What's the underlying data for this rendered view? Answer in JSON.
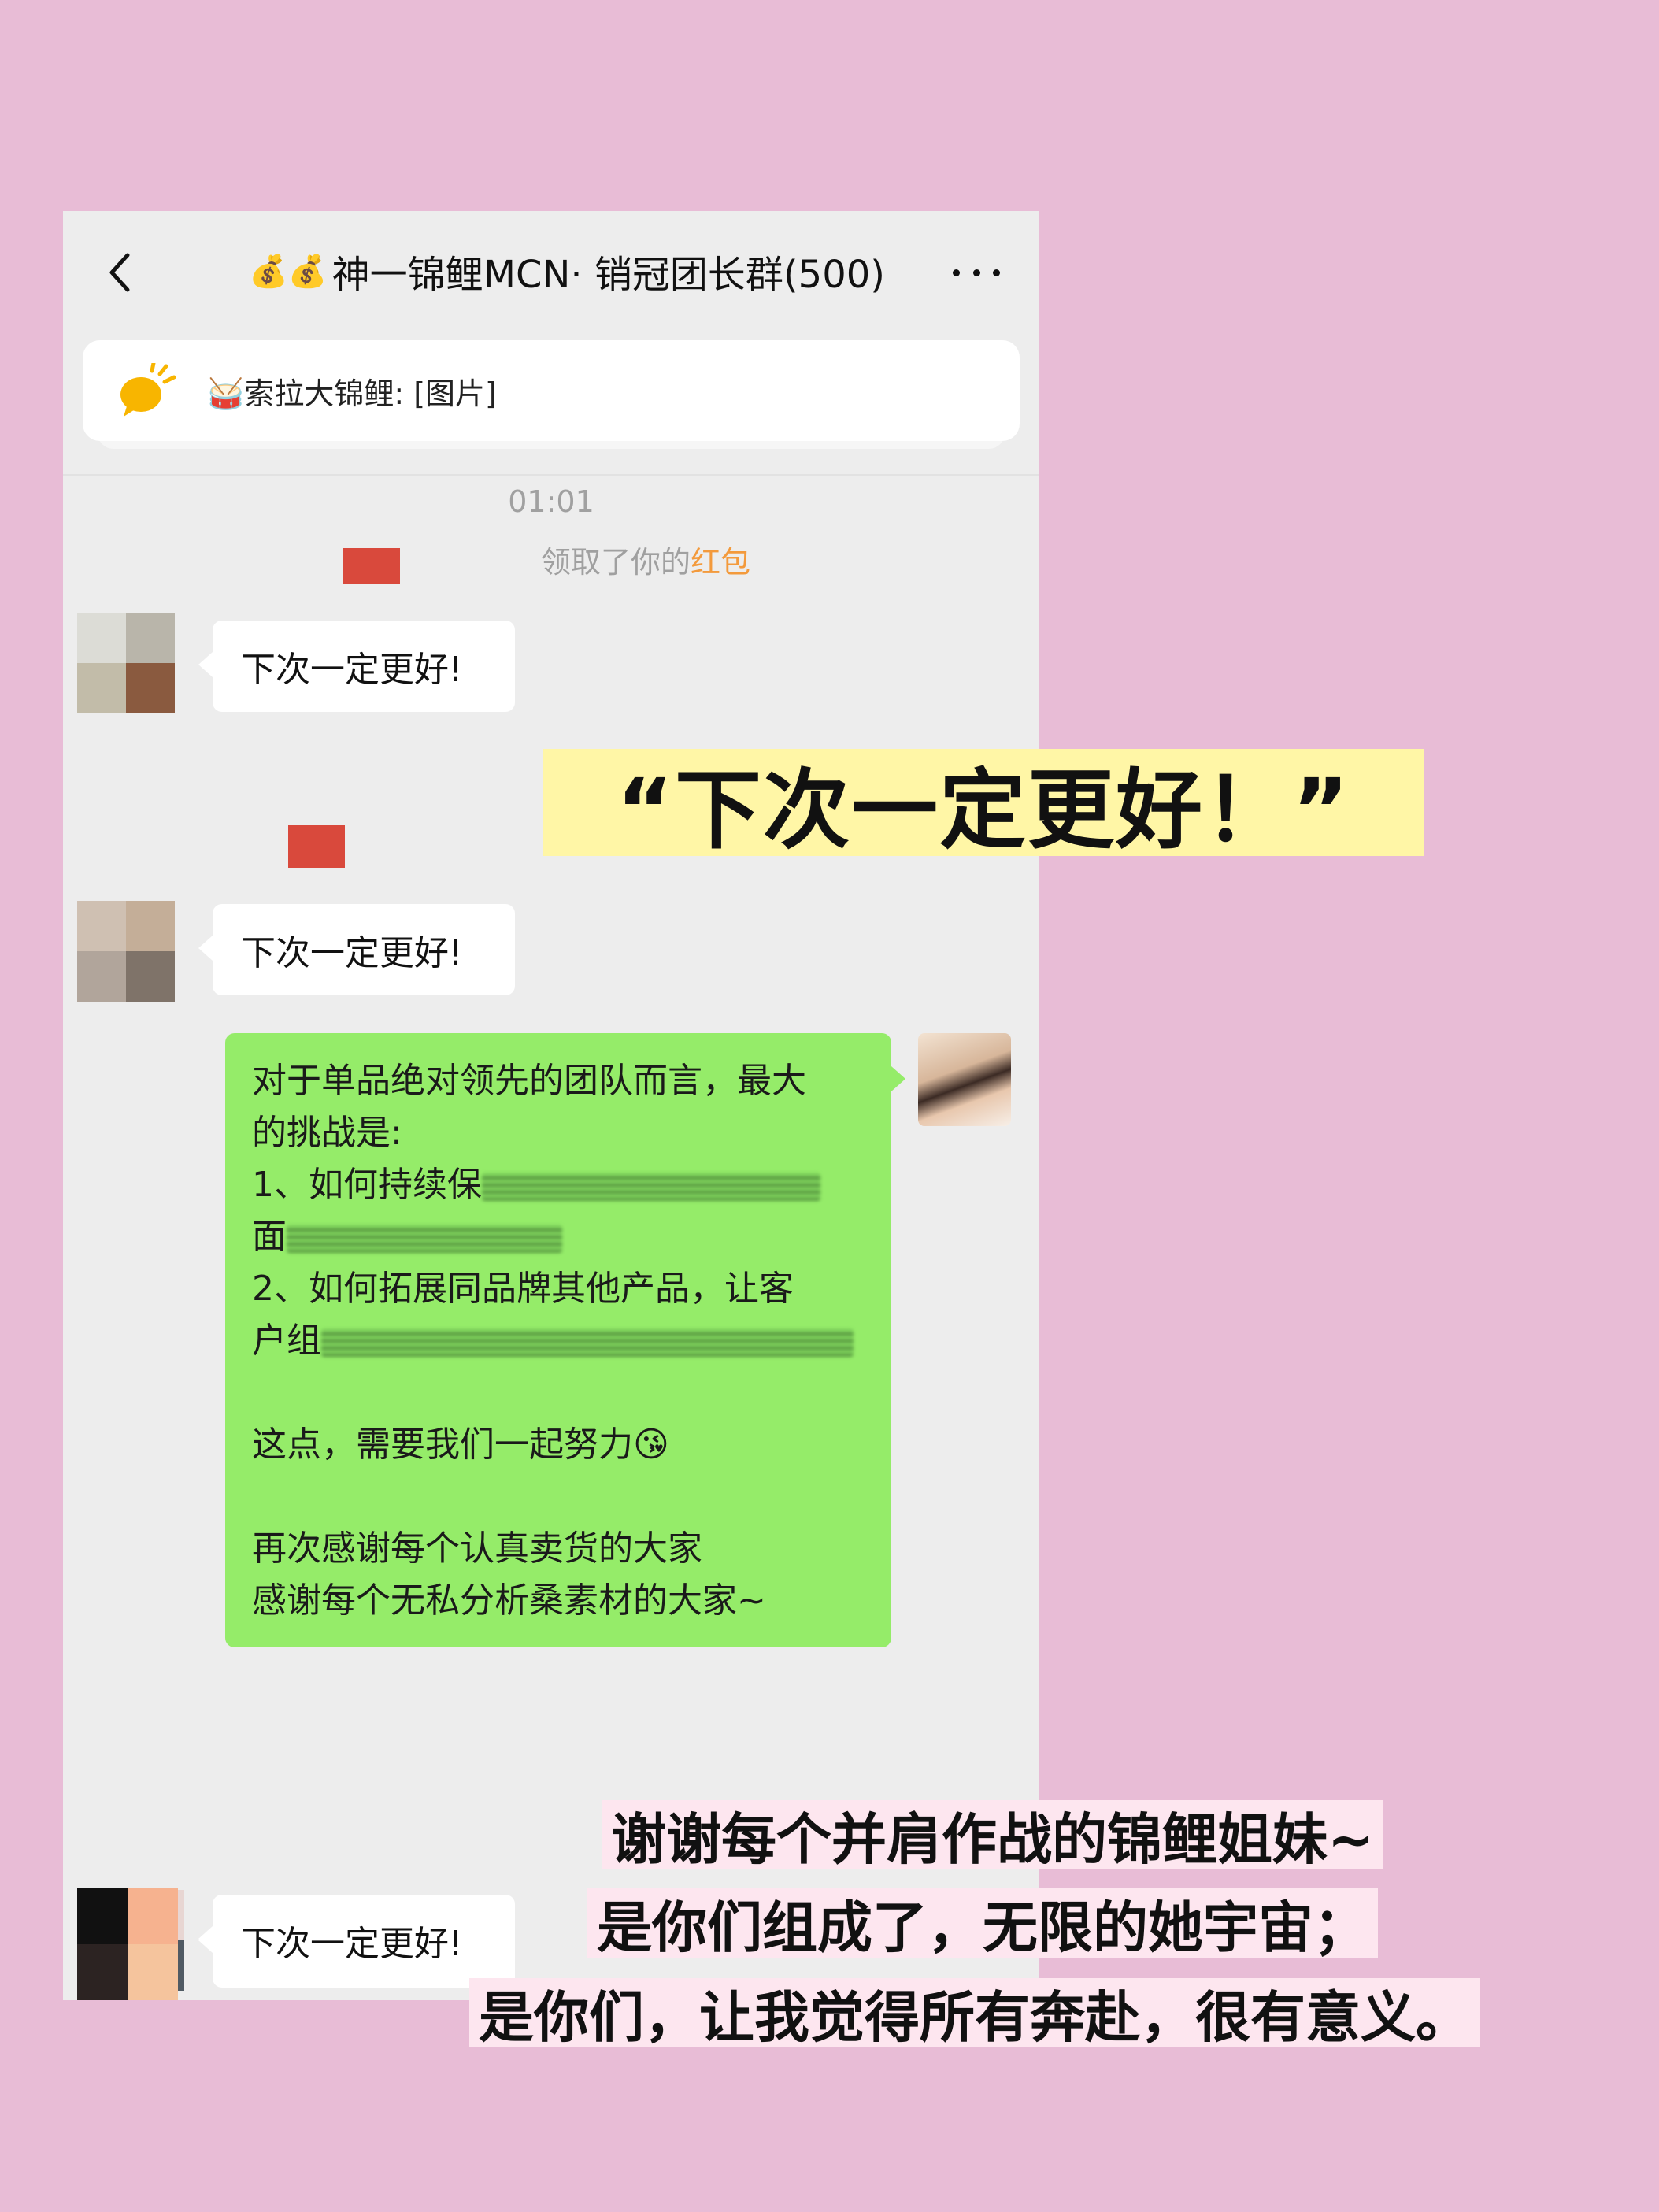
{
  "header": {
    "emoji": "💰💰",
    "title": "神一锦鲤MCN· 销冠团长群(500)"
  },
  "notice": {
    "icon": "announcement-icon",
    "text": "🥁索拉大锦鲤: [图片]"
  },
  "chat": {
    "timestamp": "01:01",
    "system_prefix": "领取了你的",
    "system_link": "红包",
    "reply": "下次一定更好!",
    "green_message": {
      "line1": "对于单品绝对领先的团队而言，最大",
      "line2": "的挑战是:",
      "line3": "1、如何持续保",
      "line4": "面",
      "line5": "2、如何拓展同品牌其他产品，让客",
      "line6": "户组",
      "line7": "这点，需要我们一起努力😘",
      "line8": "再次感谢每个认真卖货的大家",
      "line9": "感谢每个无私分析桑素材的大家~"
    }
  },
  "overlay": {
    "highlight": "“下次一定更好！”",
    "caption1": "谢谢每个并肩作战的锦鲤姐妹~",
    "caption2": "是你们组成了，无限的她宇宙；",
    "caption3": "是你们，让我觉得所有奔赴，很有意义。"
  },
  "colors": {
    "background": "#e8bcd6",
    "chat_bg": "#ededed",
    "green_bubble": "#95ec69",
    "highlight": "#fff6a6",
    "red_link": "#f39a3c"
  }
}
